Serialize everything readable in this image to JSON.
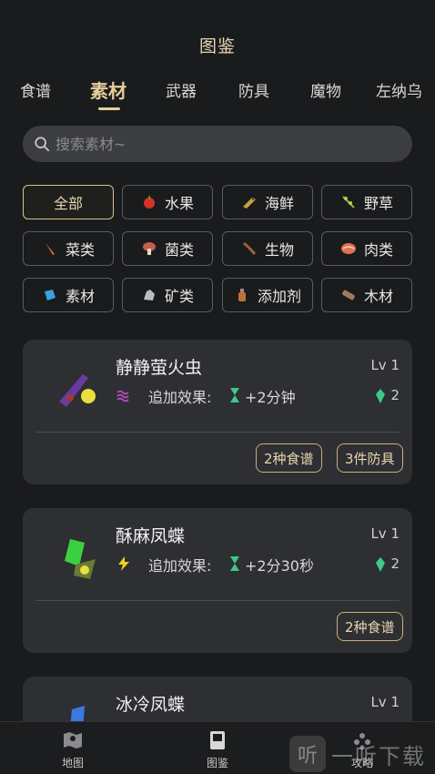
{
  "header": {
    "title": "图鉴"
  },
  "tabs": [
    {
      "label": "食谱"
    },
    {
      "label": "素材"
    },
    {
      "label": "武器"
    },
    {
      "label": "防具"
    },
    {
      "label": "魔物"
    },
    {
      "label": "左纳乌"
    }
  ],
  "search": {
    "placeholder": "搜索素材~",
    "value": ""
  },
  "filters": [
    {
      "label": "全部",
      "icon": "",
      "selected": true
    },
    {
      "label": "水果",
      "icon": "apple-icon",
      "color": "#d8302a"
    },
    {
      "label": "海鲜",
      "icon": "fish-icon",
      "color": "#c9a23a"
    },
    {
      "label": "野草",
      "icon": "herb-icon",
      "color": "#9bb83a"
    },
    {
      "label": "菜类",
      "icon": "carrot-icon",
      "color": "#e06a3a"
    },
    {
      "label": "菌类",
      "icon": "mushroom-icon",
      "color": "#c0604a"
    },
    {
      "label": "生物",
      "icon": "lizard-icon",
      "color": "#a0603a"
    },
    {
      "label": "肉类",
      "icon": "meat-icon",
      "color": "#e07050"
    },
    {
      "label": "素材",
      "icon": "material-icon",
      "color": "#3aa0e0"
    },
    {
      "label": "矿类",
      "icon": "ore-icon",
      "color": "#b8bcc4"
    },
    {
      "label": "添加剂",
      "icon": "bottle-icon",
      "color": "#c0703a"
    },
    {
      "label": "木材",
      "icon": "wood-icon",
      "color": "#a07a5a"
    }
  ],
  "cards": [
    {
      "name": "静静萤火虫",
      "level": "Lv 1",
      "effect_label": "追加效果:",
      "effect_value": "+2分钟",
      "effect_icon": "stealth-icon",
      "gem_value": "2",
      "tags": [
        "2种食谱",
        "3件防具"
      ]
    },
    {
      "name": "酥麻凤蝶",
      "level": "Lv 1",
      "effect_label": "追加效果:",
      "effect_value": "+2分30秒",
      "effect_icon": "electric-icon",
      "gem_value": "2",
      "tags": [
        "2种食谱"
      ]
    },
    {
      "name": "冰冷凤蝶",
      "level": "Lv 1"
    }
  ],
  "bottom_nav": [
    {
      "label": "地图",
      "icon": "map-icon"
    },
    {
      "label": "图鉴",
      "icon": "book-icon"
    },
    {
      "label": "攻略",
      "icon": "guide-icon"
    }
  ],
  "watermark": {
    "text": "一听下载",
    "badge": "听"
  },
  "colors": {
    "accent": "#e6cf9a",
    "background": "#1a1b1d",
    "card": "#2e2f32",
    "gem": "#3ec98a"
  }
}
